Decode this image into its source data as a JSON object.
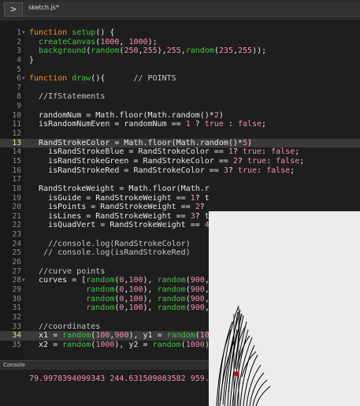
{
  "topbar": {
    "toggle_label": ">",
    "file_tab": "sketch.js*"
  },
  "code_lines": [
    {
      "n": "1",
      "fold": true,
      "html": "<span class='k'>function</span> <span class='f'>setup</span>() {"
    },
    {
      "n": "2",
      "html": "  <span class='f'>createCanvas</span>(<span class='n'>1000</span>, <span class='n'>1000</span>);"
    },
    {
      "n": "3",
      "html": "  <span class='f'>background</span>(<span class='f'>random</span>(<span class='n'>250</span>,<span class='n'>255</span>),<span class='n'>255</span>,<span class='f'>random</span>(<span class='n'>235</span>,<span class='n'>255</span>));"
    },
    {
      "n": "4",
      "html": "}"
    },
    {
      "n": "5",
      "html": ""
    },
    {
      "n": "6",
      "fold": true,
      "html": "<span class='k'>function</span> <span class='f'>draw</span>(){      <span class='c'>// POINTS</span>"
    },
    {
      "n": "7",
      "html": ""
    },
    {
      "n": "8",
      "html": "  <span class='c'>//IfStatements</span>"
    },
    {
      "n": "9",
      "html": ""
    },
    {
      "n": "10",
      "html": "  randomNum = Math.floor(Math.random()*<span class='n'>2</span>)"
    },
    {
      "n": "11",
      "html": "  isRandomNumEven = randomNum == <span class='n'>1</span> ? <span class='n'>true</span> : <span class='n'>false</span>;"
    },
    {
      "n": "12",
      "html": ""
    },
    {
      "n": "13",
      "current": true,
      "html": "  RandStrokeColor = Math.floor(Math.random()*<span class='n'>5</span>)"
    },
    {
      "n": "14",
      "html": "    isRandStrokeBlue = RandStrokeColor == <span class='n'>1</span>? <span class='n'>true</span>: <span class='n'>false</span>;"
    },
    {
      "n": "15",
      "html": "    isRandStrokeGreen = RandStrokeColor == <span class='n'>2</span>? <span class='n'>true</span>: <span class='n'>false</span>;"
    },
    {
      "n": "16",
      "html": "    isRandStrokeRed = RandStrokeColor == <span class='n'>3</span>? <span class='n'>true</span>: <span class='n'>false</span>;"
    },
    {
      "n": "17",
      "html": ""
    },
    {
      "n": "18",
      "html": "  RandStrokeWeight = Math.floor(Math.r"
    },
    {
      "n": "19",
      "html": "    isGuide = RandStrokeWeight == <span class='n'>1</span>? t"
    },
    {
      "n": "20",
      "html": "    isPoints = RandStrokeWeight == <span class='n'>2</span>?"
    },
    {
      "n": "21",
      "html": "    isLines = RandStrokeWeight == <span class='n'>3</span>? t"
    },
    {
      "n": "22",
      "html": "    isQuadVert = RandStrokeWeight == <span class='n'>4</span>"
    },
    {
      "n": "23",
      "html": ""
    },
    {
      "n": "24",
      "html": "    <span class='c'>//console.log(RandStrokeColor)</span>"
    },
    {
      "n": "25",
      "html": "   <span class='c'>// console.log(isRandStrokeRed)</span>"
    },
    {
      "n": "26",
      "html": ""
    },
    {
      "n": "27",
      "html": "  <span class='c'>//curve points</span>"
    },
    {
      "n": "28",
      "fold": true,
      "html": "  curves = [<span class='f'>random</span>(<span class='n'>0</span>,<span class='n'>100</span>), <span class='f'>random</span>(<span class='n'>900</span>,"
    },
    {
      "n": "29",
      "html": "            <span class='f'>random</span>(<span class='n'>0</span>,<span class='n'>100</span>), <span class='f'>random</span>(<span class='n'>900</span>,"
    },
    {
      "n": "30",
      "html": "            <span class='f'>random</span>(<span class='n'>0</span>,<span class='n'>100</span>), <span class='f'>random</span>(<span class='n'>900</span>,"
    },
    {
      "n": "31",
      "html": "            <span class='f'>random</span>(<span class='n'>0</span>,<span class='n'>100</span>), <span class='f'>random</span>(<span class='n'>900</span>,"
    },
    {
      "n": "32",
      "html": ""
    },
    {
      "n": "33",
      "html": "  <span class='c'>//coordinates</span>"
    },
    {
      "n": "34",
      "current": true,
      "html": "  x1 = <span class='f'>random</span>(<span class='n'>100</span>,<span class='n'>900</span>), y1 = <span class='f'>random</span>(<span class='n'>10</span>"
    },
    {
      "n": "35",
      "html": "  x2 = <span class='f'>random</span>(<span class='n'>1000</span>), y2 = <span class='f'>random</span>(<span class='n'>1000</span>)"
    }
  ],
  "console": {
    "label": "Console",
    "output": "79.9978394099343 244.631509083582 959.."
  },
  "colors": {
    "keyword": "#ff8c1a",
    "function": "#3ec43e",
    "number": "#f48fb1",
    "comment": "#c7c7c7",
    "canvas_bg": "#ececec",
    "stroke": "#000000",
    "dot": "#cc0000"
  }
}
